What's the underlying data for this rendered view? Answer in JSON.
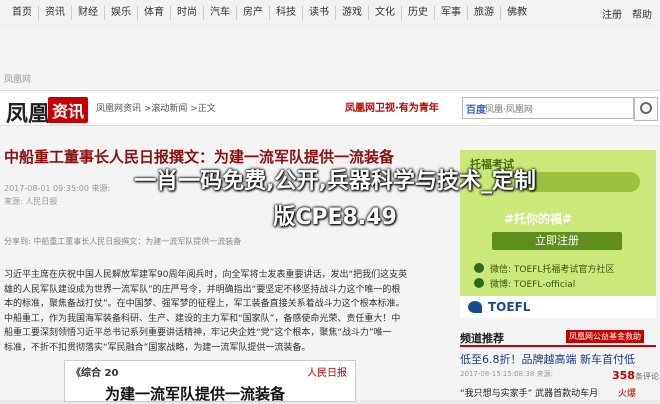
{
  "topnav": {
    "items": [
      "首页",
      "资讯",
      "财经",
      "娱乐",
      "体育",
      "时尚",
      "汽车",
      "房产",
      "科技",
      "读书",
      "游戏",
      "文化",
      "历史",
      "军事",
      "旅游",
      "佛教"
    ],
    "right": [
      "注册",
      "帮助"
    ]
  },
  "page": {
    "tiny_label": "凤凰网"
  },
  "header": {
    "logo_text": "凤凰",
    "logo_badge": "资讯",
    "breadcrumb": "凤凰网资讯 >滚动新闻 >正文",
    "promo": "凤凰网卫视·有为青年",
    "search_logo": "百度",
    "search_text": "凤凰·凤凰网"
  },
  "article": {
    "title": "中船重工董事长人民日报撰文：为建一流军队提供一流装备",
    "meta1": "2017-08-01 09:35:00 来源:",
    "meta2": "来源: 人民日报",
    "share": "分享到:",
    "share2": "中船重工董事长人民日报撰文：为建一流军队提供一流装备",
    "paragraphs": [
      "习近平主席在庆祝中国人民解放军建军90周年阅兵时，向全军将士发表重要讲话，发出“把我们这支英",
      "雄的人民军队建设成为世界一流军队”的庄严号令，并明确指出“要坚定不移坚持战斗力这个唯一的根",
      "本的标准，聚焦备战打仗”。在中国梦、强军梦的征程上，军工装备直接关系着战斗力这个根本标准。",
      "中船重工，作为我国海军装备科研、生产、建设的主力军和“国家队”，备感使命光荣、责任重大！中",
      "船重工要深刻领悟习近平总书记系列重要讲话精神，牢记央企姓“党”这个根本，聚焦“战斗力”唯一",
      "标准，不折不扣贯彻落实“军民融合”国家战略，为建一流军队提供一流装备。"
    ],
    "newspaper_head": "《综合 20",
    "newspaper_brand": "人民日报",
    "newspaper_title": "为建一流军队提供一流装备"
  },
  "overlay": {
    "line1": "一肖一码免费,公开,兵器科学与技术_定制",
    "line2": "版CPE8.49"
  },
  "ad": {
    "top": "托福考试",
    "mid": "#托你的福#",
    "button": "立即注册",
    "line1": "微信: TOEFL托福考试官方社区",
    "line2": "微博: TOEFL-official",
    "footer": "TOEFL",
    "colors": {
      "bg": "#cde87a",
      "button": "#5e8e1e"
    }
  },
  "side": {
    "heading": "频道推荐",
    "badge": "凤凰网公益基金救助",
    "item1": "低至6.8折！品牌越高端 新车首付低",
    "meta1": "2017-08-15 15:08:38 来源:",
    "score": "358",
    "score_unit": "条评论",
    "item2": "“我只想与实家手” 武器首款动车月 ",
    "item2b": "火爆"
  }
}
